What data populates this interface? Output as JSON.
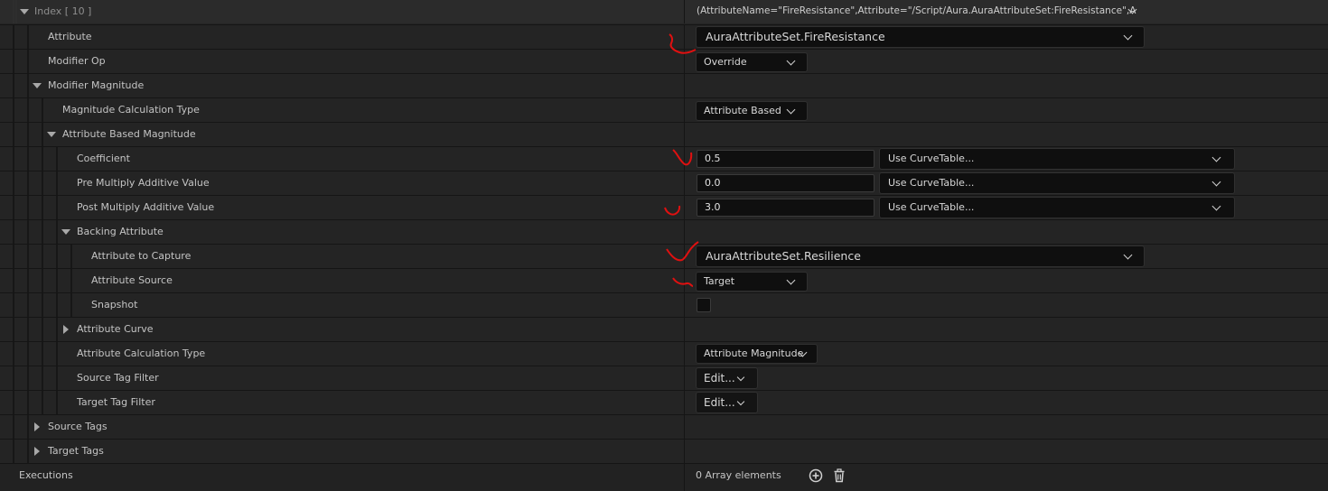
{
  "index_row": {
    "label": "Index [ 10 ]",
    "value": "(AttributeName=\"FireResistance\",Attribute=\"/Script/Aura.AuraAttributeSet:FireResistance\",A"
  },
  "rows": {
    "attribute": {
      "label": "Attribute",
      "value": "AuraAttributeSet.FireResistance"
    },
    "modifier_op": {
      "label": "Modifier Op",
      "value": "Override"
    },
    "modifier_magnitude": {
      "label": "Modifier Magnitude"
    },
    "magnitude_calc_type": {
      "label": "Magnitude Calculation Type",
      "value": "Attribute Based"
    },
    "attribute_based_magnitude": {
      "label": "Attribute Based Magnitude"
    },
    "coefficient": {
      "label": "Coefficient",
      "value": "0.5",
      "curve": "Use CurveTable..."
    },
    "pre_multiply": {
      "label": "Pre Multiply Additive Value",
      "value": "0.0",
      "curve": "Use CurveTable..."
    },
    "post_multiply": {
      "label": "Post Multiply Additive Value",
      "value": "3.0",
      "curve": "Use CurveTable..."
    },
    "backing_attribute": {
      "label": "Backing Attribute"
    },
    "attribute_to_capture": {
      "label": "Attribute to Capture",
      "value": "AuraAttributeSet.Resilience"
    },
    "attribute_source": {
      "label": "Attribute Source",
      "value": "Target"
    },
    "snapshot": {
      "label": "Snapshot",
      "checked": false
    },
    "attribute_curve": {
      "label": "Attribute Curve"
    },
    "attribute_calc_type": {
      "label": "Attribute Calculation Type",
      "value": "Attribute Magnitude"
    },
    "source_tag_filter": {
      "label": "Source Tag Filter",
      "value": "Edit..."
    },
    "target_tag_filter": {
      "label": "Target Tag Filter",
      "value": "Edit..."
    },
    "source_tags": {
      "label": "Source Tags"
    },
    "target_tags": {
      "label": "Target Tags"
    },
    "executions": {
      "label": "Executions",
      "value": "0 Array elements"
    }
  },
  "icons": [
    "chevron-down-icon",
    "expand-arrow-icon",
    "collapse-arrow-icon",
    "add-icon",
    "trash-icon"
  ],
  "colors": {
    "annotation": "#e01010",
    "background": "#242424",
    "field": "#0f0f0f"
  }
}
